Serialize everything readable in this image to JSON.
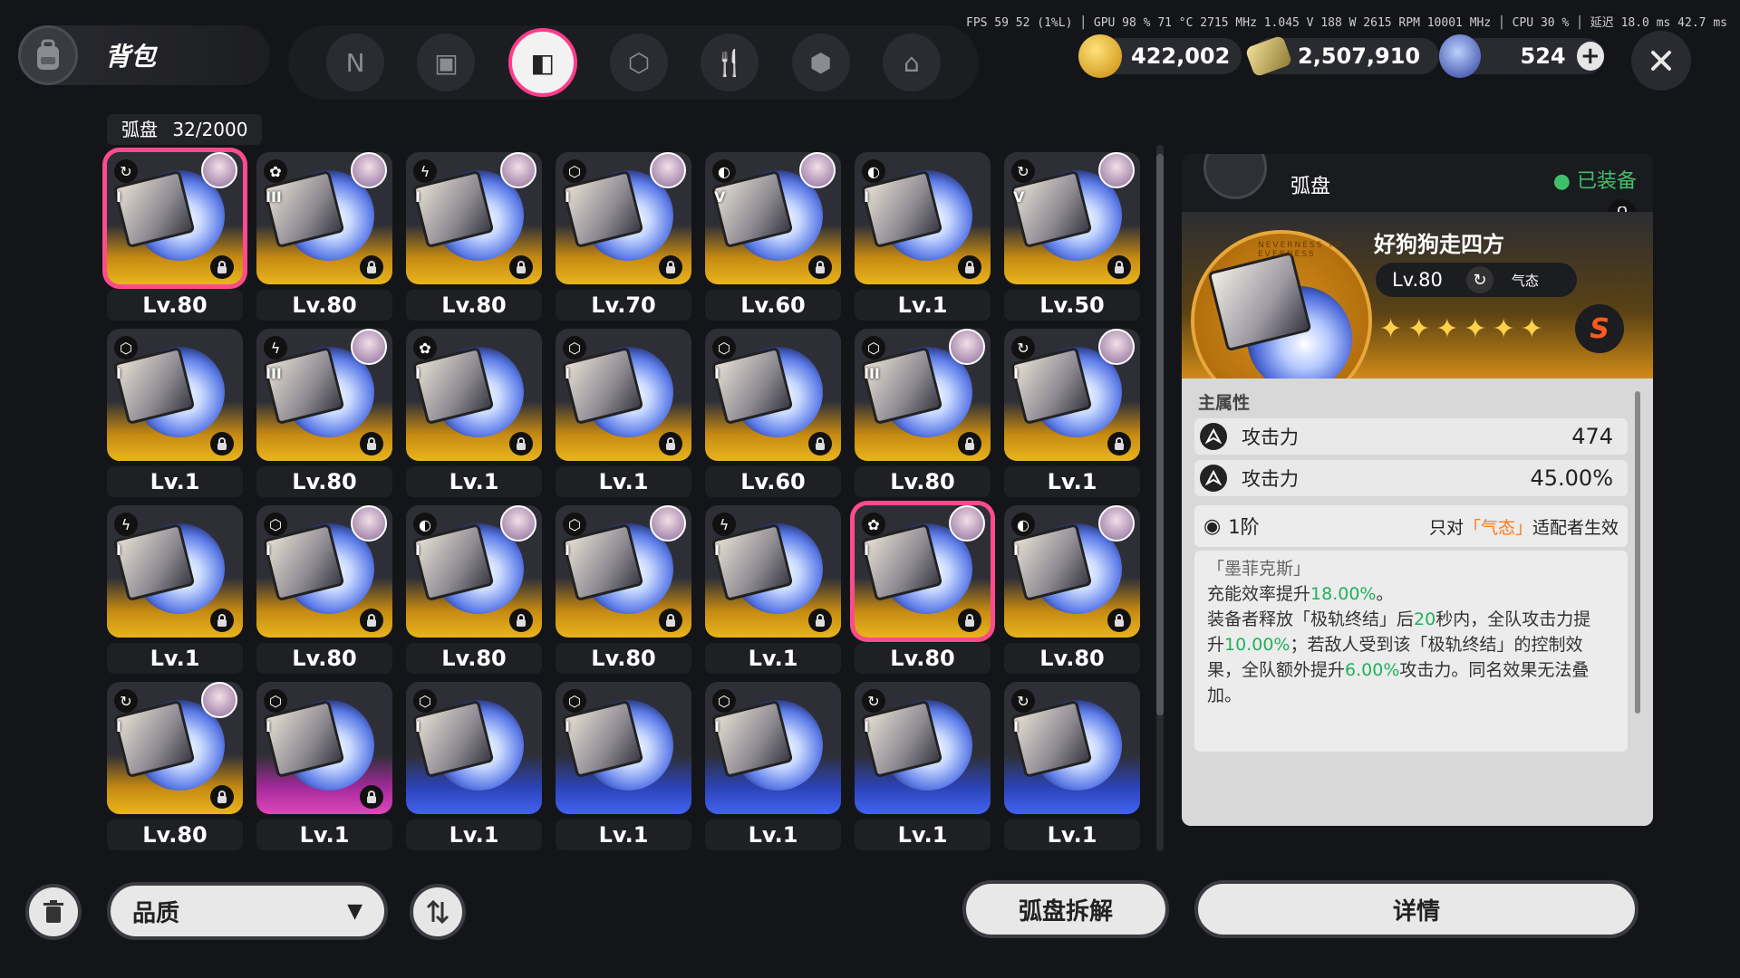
{
  "header": {
    "title": "背包"
  },
  "tabs": [
    {
      "name": "tab-disc-n-icon",
      "glyph": "N"
    },
    {
      "name": "tab-gameboy-icon",
      "glyph": "▣"
    },
    {
      "name": "tab-disc-icon",
      "glyph": "◧"
    },
    {
      "name": "tab-cube-icon",
      "glyph": "⬡"
    },
    {
      "name": "tab-food-icon",
      "glyph": "🍴"
    },
    {
      "name": "tab-box-icon",
      "glyph": "⬢"
    },
    {
      "name": "tab-house-icon",
      "glyph": "⌂"
    }
  ],
  "perf": {
    "text": "FPS  59   52 (1%L)  │ GPU  98 %  71 °C  2715 MHz  1.045 V  188 W  2615 RPM  10001 MHz  │ CPU  30 %  │ 延迟  18.0 ms  42.7 ms"
  },
  "currencies": [
    {
      "value": "422,002",
      "icon_color": "#e8b21e"
    },
    {
      "value": "2,507,910",
      "icon_color": "#d8c060"
    },
    {
      "value": "524",
      "icon_color": "#3b5ec8"
    }
  ],
  "grid": {
    "label": "弧盘",
    "count": "32/2000",
    "items": [
      {
        "lv": "Lv.80",
        "rank": "I",
        "type": "↻",
        "frame": "gold",
        "avatar": true,
        "lock": true,
        "selected": true
      },
      {
        "lv": "Lv.80",
        "rank": "III",
        "type": "✿",
        "frame": "gold",
        "avatar": true,
        "lock": true
      },
      {
        "lv": "Lv.80",
        "rank": "I",
        "type": "ϟ",
        "frame": "gold",
        "avatar": true,
        "lock": true
      },
      {
        "lv": "Lv.70",
        "rank": "I",
        "type": "⬡",
        "frame": "gold",
        "avatar": true,
        "lock": true
      },
      {
        "lv": "Lv.60",
        "rank": "V",
        "type": "◐",
        "frame": "gold",
        "avatar": true,
        "lock": true
      },
      {
        "lv": "Lv.1",
        "rank": "I",
        "type": "◐",
        "frame": "gold",
        "avatar": false,
        "lock": true
      },
      {
        "lv": "Lv.50",
        "rank": "V",
        "type": "↻",
        "frame": "gold",
        "avatar": true,
        "lock": true
      },
      {
        "lv": "Lv.1",
        "rank": "I",
        "type": "⬡",
        "frame": "gold",
        "avatar": false,
        "lock": true
      },
      {
        "lv": "Lv.80",
        "rank": "III",
        "type": "ϟ",
        "frame": "gold",
        "avatar": true,
        "lock": true
      },
      {
        "lv": "Lv.1",
        "rank": "I",
        "type": "✿",
        "frame": "gold",
        "avatar": false,
        "lock": true
      },
      {
        "lv": "Lv.1",
        "rank": "I",
        "type": "⬡",
        "frame": "gold",
        "avatar": false,
        "lock": true
      },
      {
        "lv": "Lv.60",
        "rank": "I",
        "type": "⬡",
        "frame": "gold",
        "avatar": false,
        "lock": true
      },
      {
        "lv": "Lv.80",
        "rank": "III",
        "type": "⬡",
        "frame": "gold",
        "avatar": true,
        "lock": true
      },
      {
        "lv": "Lv.1",
        "rank": "I",
        "type": "↻",
        "frame": "gold",
        "avatar": true,
        "lock": true
      },
      {
        "lv": "Lv.1",
        "rank": "I",
        "type": "ϟ",
        "frame": "gold",
        "avatar": false,
        "lock": true
      },
      {
        "lv": "Lv.80",
        "rank": "I",
        "type": "⬡",
        "frame": "gold",
        "avatar": true,
        "lock": true
      },
      {
        "lv": "Lv.80",
        "rank": "I",
        "type": "◐",
        "frame": "gold",
        "avatar": true,
        "lock": true
      },
      {
        "lv": "Lv.80",
        "rank": "I",
        "type": "⬡",
        "frame": "gold",
        "avatar": true,
        "lock": true
      },
      {
        "lv": "Lv.1",
        "rank": "I",
        "type": "ϟ",
        "frame": "gold",
        "avatar": false,
        "lock": true
      },
      {
        "lv": "Lv.80",
        "rank": "I",
        "type": "✿",
        "frame": "gold",
        "avatar": true,
        "lock": true,
        "selected": true
      },
      {
        "lv": "Lv.80",
        "rank": "I",
        "type": "◐",
        "frame": "gold",
        "avatar": true,
        "lock": true
      },
      {
        "lv": "Lv.80",
        "rank": "I",
        "type": "↻",
        "frame": "gold",
        "avatar": true,
        "lock": true
      },
      {
        "lv": "Lv.1",
        "rank": "I",
        "type": "⬡",
        "frame": "purple",
        "avatar": false,
        "lock": true
      },
      {
        "lv": "Lv.1",
        "rank": "I",
        "type": "⬡",
        "frame": "blue",
        "avatar": false,
        "lock": false
      },
      {
        "lv": "Lv.1",
        "rank": "I",
        "type": "⬡",
        "frame": "blue",
        "avatar": false,
        "lock": false
      },
      {
        "lv": "Lv.1",
        "rank": "I",
        "type": "⬡",
        "frame": "blue",
        "avatar": false,
        "lock": false
      },
      {
        "lv": "Lv.1",
        "rank": "I",
        "type": "↻",
        "frame": "blue",
        "avatar": false,
        "lock": false
      },
      {
        "lv": "Lv.1",
        "rank": "I",
        "type": "↻",
        "frame": "blue",
        "avatar": false,
        "lock": false
      }
    ]
  },
  "detail": {
    "header": "弧盘",
    "equipped": "已装备",
    "name": "好狗狗走四方",
    "level": "Lv.80",
    "type_label": "气态",
    "stars": 6,
    "rank_badge": "S",
    "main_attr_title": "主属性",
    "stats": [
      {
        "label": "攻击力",
        "value": "474"
      },
      {
        "label": "攻击力",
        "value": "45.00%"
      }
    ],
    "tier": "1阶",
    "restriction_pre": "只对",
    "restriction_key": "「气态」",
    "restriction_post": "适配者生效",
    "effect_name": "「墨菲克斯」",
    "effect_l1a": "充能效率提升",
    "effect_l1b": "18.00%",
    "effect_l1c": "。",
    "effect_l2a": "装备者释放「极轨终结」后",
    "effect_l2b": "20",
    "effect_l2c": "秒内，全队攻击力提",
    "effect_l3a": "升",
    "effect_l3b": "10.00%",
    "effect_l3c": "；若敌人受到该「极轨终结」的控制效",
    "effect_l4a": "果，全队额外提升",
    "effect_l4b": "6.00%",
    "effect_l4c": "攻击力。同名效果无法叠",
    "effect_l5": "加。",
    "seal_text": "NEVERNESS TO EVERNESS"
  },
  "bottom": {
    "filter_label": "品质",
    "dismantle_label": "弧盘拆解",
    "details_label": "详情"
  }
}
